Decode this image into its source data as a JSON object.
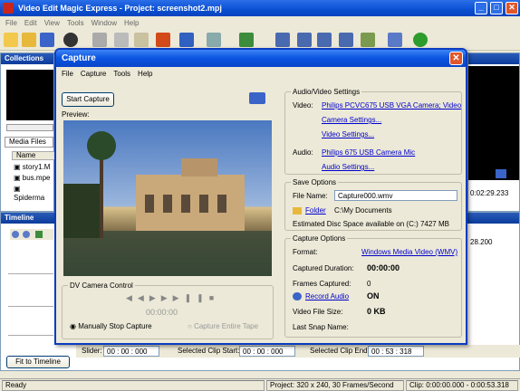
{
  "app": {
    "title": "Video Edit Magic Express - Project: screenshot2.mpj"
  },
  "menu": {
    "items": [
      "File",
      "Edit",
      "View",
      "Tools",
      "Window",
      "Help"
    ]
  },
  "panels": {
    "collections": "Collections",
    "media_files_tab": "Media Files",
    "name_header": "Name",
    "files": [
      "story1.M",
      "bus.mpe",
      "Spiderma"
    ],
    "timeline": "Timeline",
    "fit_to_timeline": "Fit to Timeline",
    "time_right": "0:02:29.233",
    "ruler_mark": "28.200"
  },
  "bottom_bar": {
    "slider_label": "Slider:",
    "slider_value": "00 : 00 : 000",
    "clip_start_label": "Selected Clip Start:",
    "clip_start_value": "00 : 00 : 000",
    "clip_end_label": "Selected Clip End:",
    "clip_end_value": "00 : 53 : 318"
  },
  "status": {
    "ready": "Ready",
    "project": "Project: 320 x 240, 30 Frames/Second",
    "clip": "Clip: 0:00:00.000 - 0:00:53.318"
  },
  "dialog": {
    "title": "Capture",
    "menu": [
      "File",
      "Capture",
      "Tools",
      "Help"
    ],
    "start_capture": "Start Capture",
    "preview": "Preview:",
    "av_settings": {
      "title": "Audio/Video Settings",
      "video_label": "Video:",
      "video_device": "Philips PCVC675 USB VGA Camera; Video",
      "camera_settings": "Camera Settings...",
      "video_settings": "Video Settings...",
      "audio_label": "Audio:",
      "audio_device": "Philips 675 USB Camera Mic",
      "audio_settings": "Audio Settings..."
    },
    "save_options": {
      "title": "Save Options",
      "file_name_label": "File Name:",
      "file_name": "Capture000.wmv",
      "folder_link": "Folder",
      "folder_path": "C:\\My Documents",
      "disc_space": "Estimated Disc Space available on (C:) 7427 MB"
    },
    "capture_options": {
      "title": "Capture Options",
      "format_label": "Format:",
      "format_value": "Windows Media Video (WMV)",
      "duration_label": "Captured Duration:",
      "duration_value": "00:00:00",
      "frames_label": "Frames Captured:",
      "frames_value": "0",
      "record_audio": "Record Audio",
      "record_audio_state": "ON",
      "file_size_label": "Video File Size:",
      "file_size_value": "0 KB",
      "last_snap_label": "Last Snap Name:"
    },
    "dv": {
      "title": "DV Camera Control",
      "timecode": "00:00:00",
      "manual_stop": "Manually Stop Capture",
      "capture_tape": "Capture Entire Tape"
    }
  },
  "colors": {
    "title_blue": "#0a4fd2",
    "link": "#0000cc",
    "close_red": "#e1562a"
  }
}
